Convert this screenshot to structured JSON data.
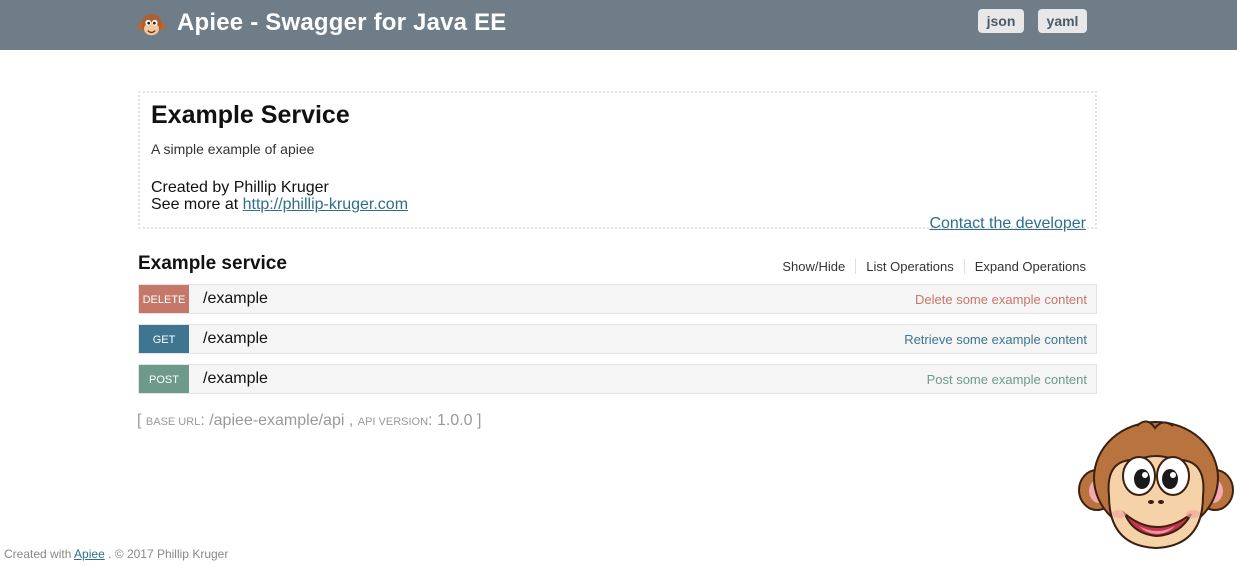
{
  "header": {
    "title": "Apiee - Swagger for Java EE",
    "json_label": "json",
    "yaml_label": "yaml",
    "color": "#6e7d88"
  },
  "info": {
    "title": "Example Service",
    "description": "A simple example of apiee",
    "created_by": "Created by Phillip Kruger",
    "see_more_prefix": "See more at",
    "url": "http://phillip-kruger.com",
    "contact_label": "Contact the developer"
  },
  "resource": {
    "name": "Example service",
    "links": [
      "Show/Hide",
      "List Operations",
      "Expand Operations"
    ],
    "operations": [
      {
        "method": "DELETE",
        "path": "/example",
        "summary": "Delete some example content",
        "color": "#c5786a"
      },
      {
        "method": "GET",
        "path": "/example",
        "summary": "Retrieve some example content",
        "color": "#3e7591"
      },
      {
        "method": "POST",
        "path": "/example",
        "summary": "Post some example content",
        "color": "#6d9a8a"
      }
    ]
  },
  "footer_info": {
    "base_url_label": "BASE URL",
    "base_url": "/apiee-example/api",
    "api_version_label": "API VERSION",
    "api_version": "1.0.0"
  },
  "credit": {
    "prefix": "Created with",
    "link": "Apiee",
    "suffix": ". © 2017 Phillip Kruger"
  },
  "icons": {
    "logo": "monkey-logo-icon",
    "mascot": "monkey-mascot-icon"
  }
}
